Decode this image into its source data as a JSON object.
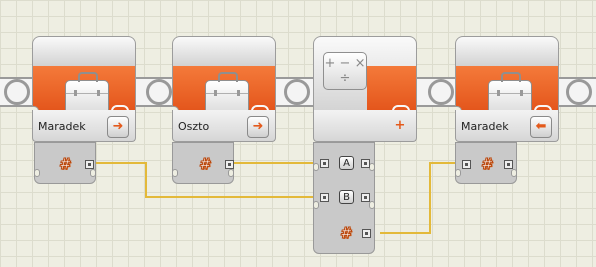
{
  "blocks": [
    {
      "label": "Maradek",
      "kind": "variable",
      "mode": "read"
    },
    {
      "label": "Oszto",
      "kind": "variable",
      "mode": "read"
    },
    {
      "label": "",
      "kind": "math",
      "operator": "+",
      "icon_symbols": "+ − × ÷",
      "inputs": [
        "A",
        "B"
      ]
    },
    {
      "label": "Maradek",
      "kind": "variable",
      "mode": "write"
    }
  ],
  "wire_color": "#e3b93a",
  "accent_color": "#e85d21",
  "symbols": {
    "number": "#"
  }
}
